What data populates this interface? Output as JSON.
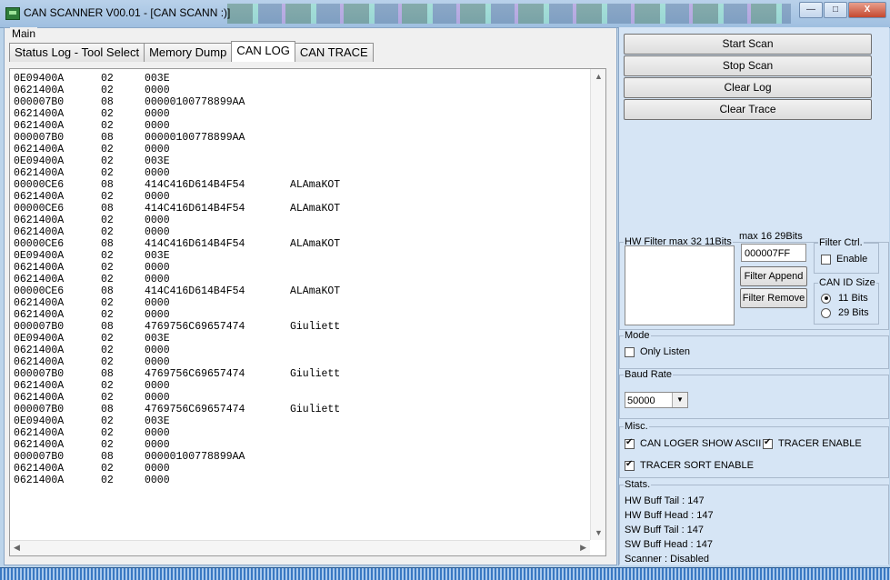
{
  "window": {
    "title": "CAN SCANNER V00.01 - [CAN SCANN :)]",
    "controls": {
      "minimize": "—",
      "maximize": "□",
      "close": "X"
    }
  },
  "main": {
    "group_label": "Main",
    "tabs": [
      {
        "label": "Status Log - Tool Select",
        "active": false
      },
      {
        "label": "Memory Dump",
        "active": false
      },
      {
        "label": "CAN LOG",
        "active": true
      },
      {
        "label": "CAN TRACE",
        "active": false
      }
    ],
    "log": [
      {
        "id": "0E09400A",
        "len": "02",
        "data": "003E",
        "ascii": ""
      },
      {
        "id": "0621400A",
        "len": "02",
        "data": "0000",
        "ascii": ""
      },
      {
        "id": "000007B0",
        "len": "08",
        "data": "00000100778899AA",
        "ascii": ""
      },
      {
        "id": "0621400A",
        "len": "02",
        "data": "0000",
        "ascii": ""
      },
      {
        "id": "0621400A",
        "len": "02",
        "data": "0000",
        "ascii": ""
      },
      {
        "id": "000007B0",
        "len": "08",
        "data": "00000100778899AA",
        "ascii": ""
      },
      {
        "id": "0621400A",
        "len": "02",
        "data": "0000",
        "ascii": ""
      },
      {
        "id": "0E09400A",
        "len": "02",
        "data": "003E",
        "ascii": ""
      },
      {
        "id": "0621400A",
        "len": "02",
        "data": "0000",
        "ascii": ""
      },
      {
        "id": "00000CE6",
        "len": "08",
        "data": "414C416D614B4F54",
        "ascii": "ALAmaKOT"
      },
      {
        "id": "0621400A",
        "len": "02",
        "data": "0000",
        "ascii": ""
      },
      {
        "id": "00000CE6",
        "len": "08",
        "data": "414C416D614B4F54",
        "ascii": "ALAmaKOT"
      },
      {
        "id": "0621400A",
        "len": "02",
        "data": "0000",
        "ascii": ""
      },
      {
        "id": "0621400A",
        "len": "02",
        "data": "0000",
        "ascii": ""
      },
      {
        "id": "00000CE6",
        "len": "08",
        "data": "414C416D614B4F54",
        "ascii": "ALAmaKOT"
      },
      {
        "id": "0E09400A",
        "len": "02",
        "data": "003E",
        "ascii": ""
      },
      {
        "id": "0621400A",
        "len": "02",
        "data": "0000",
        "ascii": ""
      },
      {
        "id": "0621400A",
        "len": "02",
        "data": "0000",
        "ascii": ""
      },
      {
        "id": "00000CE6",
        "len": "08",
        "data": "414C416D614B4F54",
        "ascii": "ALAmaKOT"
      },
      {
        "id": "0621400A",
        "len": "02",
        "data": "0000",
        "ascii": ""
      },
      {
        "id": "0621400A",
        "len": "02",
        "data": "0000",
        "ascii": ""
      },
      {
        "id": "000007B0",
        "len": "08",
        "data": "4769756C69657474",
        "ascii": "Giuliett"
      },
      {
        "id": "0E09400A",
        "len": "02",
        "data": "003E",
        "ascii": ""
      },
      {
        "id": "0621400A",
        "len": "02",
        "data": "0000",
        "ascii": ""
      },
      {
        "id": "0621400A",
        "len": "02",
        "data": "0000",
        "ascii": ""
      },
      {
        "id": "000007B0",
        "len": "08",
        "data": "4769756C69657474",
        "ascii": "Giuliett"
      },
      {
        "id": "0621400A",
        "len": "02",
        "data": "0000",
        "ascii": ""
      },
      {
        "id": "0621400A",
        "len": "02",
        "data": "0000",
        "ascii": ""
      },
      {
        "id": "000007B0",
        "len": "08",
        "data": "4769756C69657474",
        "ascii": "Giuliett"
      },
      {
        "id": "0E09400A",
        "len": "02",
        "data": "003E",
        "ascii": ""
      },
      {
        "id": "0621400A",
        "len": "02",
        "data": "0000",
        "ascii": ""
      },
      {
        "id": "0621400A",
        "len": "02",
        "data": "0000",
        "ascii": ""
      },
      {
        "id": "000007B0",
        "len": "08",
        "data": "00000100778899AA",
        "ascii": ""
      },
      {
        "id": "0621400A",
        "len": "02",
        "data": "0000",
        "ascii": ""
      },
      {
        "id": "0621400A",
        "len": "02",
        "data": "0000",
        "ascii": ""
      }
    ]
  },
  "actions": {
    "start_scan": "Start Scan",
    "stop_scan": "Stop Scan",
    "clear_log": "Clear Log",
    "clear_trace": "Clear Trace"
  },
  "hw_filter": {
    "title": "HW Filter  max 32 11Bits",
    "max_29": "max 16 29Bits",
    "filter_value": "000007FF",
    "append": "Filter Append",
    "remove": "Filter Remove",
    "filter_ctrl": {
      "title": "Filter Ctrl.",
      "enable_label": "Enable",
      "enable_checked": false
    },
    "can_id_size": {
      "title": "CAN ID Size",
      "opt_11": "11 Bits",
      "opt_29": "29 Bits",
      "selected": "11 Bits"
    }
  },
  "mode": {
    "title": "Mode",
    "only_listen": "Only Listen",
    "only_listen_checked": false
  },
  "baud": {
    "title": "Baud Rate",
    "value": "50000"
  },
  "misc": {
    "title": "Misc.",
    "show_ascii": "CAN LOGER SHOW ASCII",
    "show_ascii_checked": true,
    "tracer_enable": "TRACER ENABLE",
    "tracer_enable_checked": true,
    "tracer_sort": "TRACER SORT ENABLE",
    "tracer_sort_checked": true
  },
  "stats": {
    "title": "Stats.",
    "hw_tail": "HW Buff  Tail : 147",
    "hw_head": "HW Buff  Head : 147",
    "sw_tail": "SW Buff  Tail : 147",
    "sw_head": "SW Buff  Head : 147",
    "scanner": "Scanner : Disabled"
  },
  "colors": {
    "window_bg": "#bcd4ea",
    "panel_bg": "#d6e5f5",
    "statusbar": "#3a78c2"
  }
}
